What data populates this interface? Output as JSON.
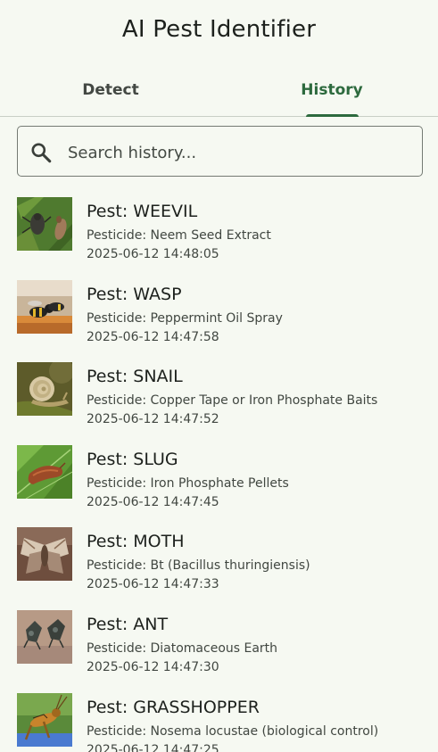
{
  "app": {
    "title": "AI Pest Identifier"
  },
  "tabs": [
    {
      "label": "Detect",
      "selected": false
    },
    {
      "label": "History",
      "selected": true
    }
  ],
  "colors": {
    "accent": "#2d6a3e",
    "background": "#f6f9f2"
  },
  "search": {
    "icon": "search-icon",
    "placeholder": "Search history...",
    "value": ""
  },
  "history": [
    {
      "pest": "Pest: WEEVIL",
      "pesticide": "Pesticide: Neem Seed Extract",
      "timestamp": "2025-06-12 14:48:05",
      "thumbnail": "weevil-photo"
    },
    {
      "pest": "Pest: WASP",
      "pesticide": "Pesticide: Peppermint Oil Spray",
      "timestamp": "2025-06-12 14:47:58",
      "thumbnail": "wasp-photo"
    },
    {
      "pest": "Pest: SNAIL",
      "pesticide": "Pesticide: Copper Tape or Iron Phosphate Baits",
      "timestamp": "2025-06-12 14:47:52",
      "thumbnail": "snail-photo"
    },
    {
      "pest": "Pest: SLUG",
      "pesticide": "Pesticide: Iron Phosphate Pellets",
      "timestamp": "2025-06-12 14:47:45",
      "thumbnail": "slug-photo"
    },
    {
      "pest": "Pest: MOTH",
      "pesticide": "Pesticide: Bt (Bacillus thuringiensis)",
      "timestamp": "2025-06-12 14:47:33",
      "thumbnail": "moth-photo"
    },
    {
      "pest": "Pest: ANT",
      "pesticide": "Pesticide: Diatomaceous Earth",
      "timestamp": "2025-06-12 14:47:30",
      "thumbnail": "ant-photo"
    },
    {
      "pest": "Pest: GRASSHOPPER",
      "pesticide": "Pesticide: Nosema locustae (biological control)",
      "timestamp": "2025-06-12 14:47:25",
      "thumbnail": "grasshopper-photo"
    }
  ]
}
